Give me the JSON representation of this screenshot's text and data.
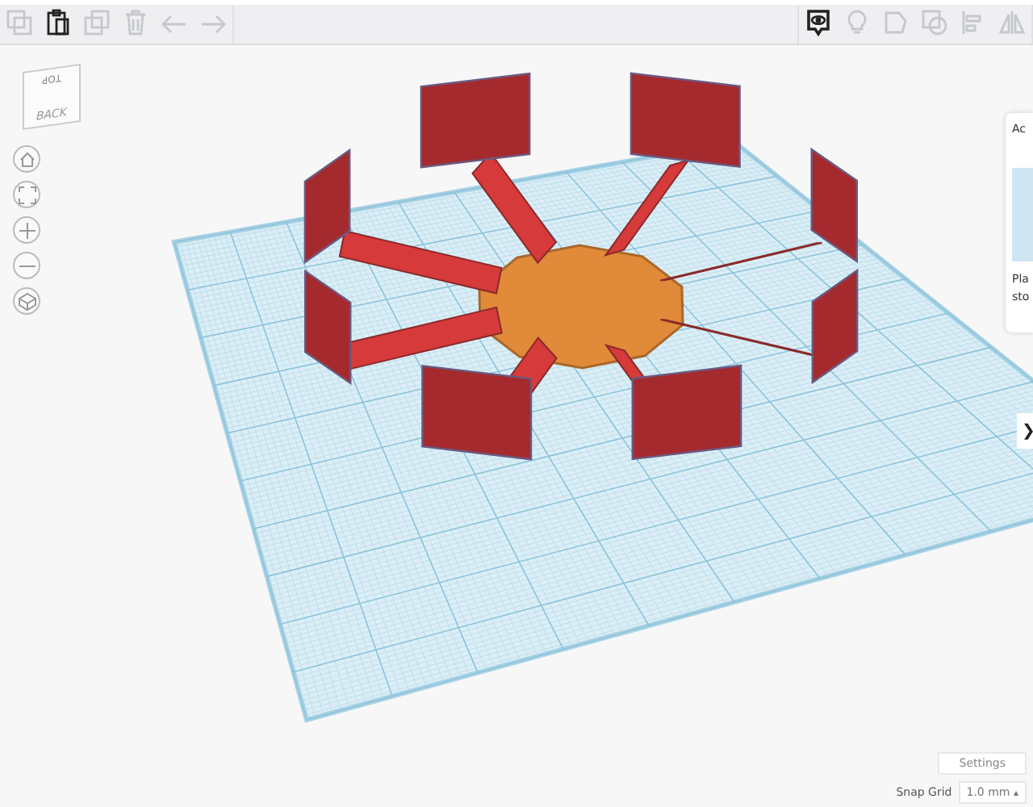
{
  "toolbar": {
    "left": [
      {
        "kind": "copy",
        "disabled": true
      },
      {
        "kind": "paste",
        "disabled": false
      },
      {
        "kind": "duplicate",
        "disabled": true
      },
      {
        "kind": "delete",
        "disabled": true
      },
      {
        "kind": "undo",
        "disabled": true
      },
      {
        "kind": "redo",
        "disabled": true
      }
    ],
    "right": [
      {
        "kind": "notes",
        "disabled": false
      },
      {
        "kind": "bulb",
        "disabled": true
      },
      {
        "kind": "shape",
        "disabled": true
      },
      {
        "kind": "hole",
        "disabled": true
      },
      {
        "kind": "align",
        "disabled": true
      },
      {
        "kind": "mirror",
        "disabled": true
      }
    ]
  },
  "view_cube": {
    "top_label": "TOP",
    "front_label": "BACK"
  },
  "view_controls": [
    {
      "kind": "home"
    },
    {
      "kind": "fit"
    },
    {
      "kind": "zoom-in"
    },
    {
      "kind": "zoom-out"
    },
    {
      "kind": "perspective"
    }
  ],
  "side_panel": {
    "title": "Ac",
    "lines": [
      "Pla",
      "sto"
    ]
  },
  "panel_toggle": "❯",
  "settings_button": "Settings",
  "snap_grid": {
    "label": "Snap Grid",
    "value": "1.0 mm",
    "caret": "▴"
  }
}
